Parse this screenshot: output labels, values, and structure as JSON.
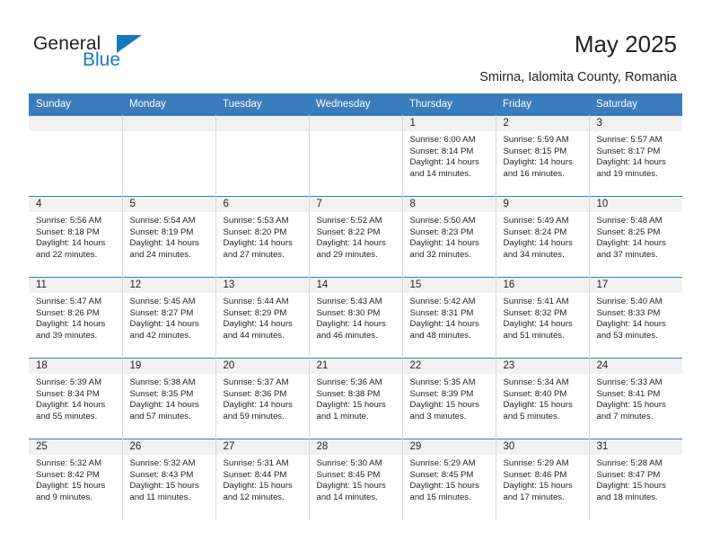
{
  "brand": {
    "name_top": "General",
    "name_bottom": "Blue",
    "accent_color": "#1878be"
  },
  "header": {
    "title": "May 2025",
    "subtitle": "Smirna, Ialomita County, Romania"
  },
  "calendar": {
    "header_bg": "#3b7cbd",
    "daynum_bg": "#f1f1f1",
    "weekday_labels": [
      "Sunday",
      "Monday",
      "Tuesday",
      "Wednesday",
      "Thursday",
      "Friday",
      "Saturday"
    ],
    "weeks": [
      [
        {
          "day": ""
        },
        {
          "day": ""
        },
        {
          "day": ""
        },
        {
          "day": ""
        },
        {
          "day": "1",
          "sunrise": "Sunrise: 6:00 AM",
          "sunset": "Sunset: 8:14 PM",
          "daylight": "Daylight: 14 hours and 14 minutes."
        },
        {
          "day": "2",
          "sunrise": "Sunrise: 5:59 AM",
          "sunset": "Sunset: 8:15 PM",
          "daylight": "Daylight: 14 hours and 16 minutes."
        },
        {
          "day": "3",
          "sunrise": "Sunrise: 5:57 AM",
          "sunset": "Sunset: 8:17 PM",
          "daylight": "Daylight: 14 hours and 19 minutes."
        }
      ],
      [
        {
          "day": "4",
          "sunrise": "Sunrise: 5:56 AM",
          "sunset": "Sunset: 8:18 PM",
          "daylight": "Daylight: 14 hours and 22 minutes."
        },
        {
          "day": "5",
          "sunrise": "Sunrise: 5:54 AM",
          "sunset": "Sunset: 8:19 PM",
          "daylight": "Daylight: 14 hours and 24 minutes."
        },
        {
          "day": "6",
          "sunrise": "Sunrise: 5:53 AM",
          "sunset": "Sunset: 8:20 PM",
          "daylight": "Daylight: 14 hours and 27 minutes."
        },
        {
          "day": "7",
          "sunrise": "Sunrise: 5:52 AM",
          "sunset": "Sunset: 8:22 PM",
          "daylight": "Daylight: 14 hours and 29 minutes."
        },
        {
          "day": "8",
          "sunrise": "Sunrise: 5:50 AM",
          "sunset": "Sunset: 8:23 PM",
          "daylight": "Daylight: 14 hours and 32 minutes."
        },
        {
          "day": "9",
          "sunrise": "Sunrise: 5:49 AM",
          "sunset": "Sunset: 8:24 PM",
          "daylight": "Daylight: 14 hours and 34 minutes."
        },
        {
          "day": "10",
          "sunrise": "Sunrise: 5:48 AM",
          "sunset": "Sunset: 8:25 PM",
          "daylight": "Daylight: 14 hours and 37 minutes."
        }
      ],
      [
        {
          "day": "11",
          "sunrise": "Sunrise: 5:47 AM",
          "sunset": "Sunset: 8:26 PM",
          "daylight": "Daylight: 14 hours and 39 minutes."
        },
        {
          "day": "12",
          "sunrise": "Sunrise: 5:45 AM",
          "sunset": "Sunset: 8:27 PM",
          "daylight": "Daylight: 14 hours and 42 minutes."
        },
        {
          "day": "13",
          "sunrise": "Sunrise: 5:44 AM",
          "sunset": "Sunset: 8:29 PM",
          "daylight": "Daylight: 14 hours and 44 minutes."
        },
        {
          "day": "14",
          "sunrise": "Sunrise: 5:43 AM",
          "sunset": "Sunset: 8:30 PM",
          "daylight": "Daylight: 14 hours and 46 minutes."
        },
        {
          "day": "15",
          "sunrise": "Sunrise: 5:42 AM",
          "sunset": "Sunset: 8:31 PM",
          "daylight": "Daylight: 14 hours and 48 minutes."
        },
        {
          "day": "16",
          "sunrise": "Sunrise: 5:41 AM",
          "sunset": "Sunset: 8:32 PM",
          "daylight": "Daylight: 14 hours and 51 minutes."
        },
        {
          "day": "17",
          "sunrise": "Sunrise: 5:40 AM",
          "sunset": "Sunset: 8:33 PM",
          "daylight": "Daylight: 14 hours and 53 minutes."
        }
      ],
      [
        {
          "day": "18",
          "sunrise": "Sunrise: 5:39 AM",
          "sunset": "Sunset: 8:34 PM",
          "daylight": "Daylight: 14 hours and 55 minutes."
        },
        {
          "day": "19",
          "sunrise": "Sunrise: 5:38 AM",
          "sunset": "Sunset: 8:35 PM",
          "daylight": "Daylight: 14 hours and 57 minutes."
        },
        {
          "day": "20",
          "sunrise": "Sunrise: 5:37 AM",
          "sunset": "Sunset: 8:36 PM",
          "daylight": "Daylight: 14 hours and 59 minutes."
        },
        {
          "day": "21",
          "sunrise": "Sunrise: 5:36 AM",
          "sunset": "Sunset: 8:38 PM",
          "daylight": "Daylight: 15 hours and 1 minute."
        },
        {
          "day": "22",
          "sunrise": "Sunrise: 5:35 AM",
          "sunset": "Sunset: 8:39 PM",
          "daylight": "Daylight: 15 hours and 3 minutes."
        },
        {
          "day": "23",
          "sunrise": "Sunrise: 5:34 AM",
          "sunset": "Sunset: 8:40 PM",
          "daylight": "Daylight: 15 hours and 5 minutes."
        },
        {
          "day": "24",
          "sunrise": "Sunrise: 5:33 AM",
          "sunset": "Sunset: 8:41 PM",
          "daylight": "Daylight: 15 hours and 7 minutes."
        }
      ],
      [
        {
          "day": "25",
          "sunrise": "Sunrise: 5:32 AM",
          "sunset": "Sunset: 8:42 PM",
          "daylight": "Daylight: 15 hours and 9 minutes."
        },
        {
          "day": "26",
          "sunrise": "Sunrise: 5:32 AM",
          "sunset": "Sunset: 8:43 PM",
          "daylight": "Daylight: 15 hours and 11 minutes."
        },
        {
          "day": "27",
          "sunrise": "Sunrise: 5:31 AM",
          "sunset": "Sunset: 8:44 PM",
          "daylight": "Daylight: 15 hours and 12 minutes."
        },
        {
          "day": "28",
          "sunrise": "Sunrise: 5:30 AM",
          "sunset": "Sunset: 8:45 PM",
          "daylight": "Daylight: 15 hours and 14 minutes."
        },
        {
          "day": "29",
          "sunrise": "Sunrise: 5:29 AM",
          "sunset": "Sunset: 8:45 PM",
          "daylight": "Daylight: 15 hours and 15 minutes."
        },
        {
          "day": "30",
          "sunrise": "Sunrise: 5:29 AM",
          "sunset": "Sunset: 8:46 PM",
          "daylight": "Daylight: 15 hours and 17 minutes."
        },
        {
          "day": "31",
          "sunrise": "Sunrise: 5:28 AM",
          "sunset": "Sunset: 8:47 PM",
          "daylight": "Daylight: 15 hours and 18 minutes."
        }
      ]
    ]
  }
}
